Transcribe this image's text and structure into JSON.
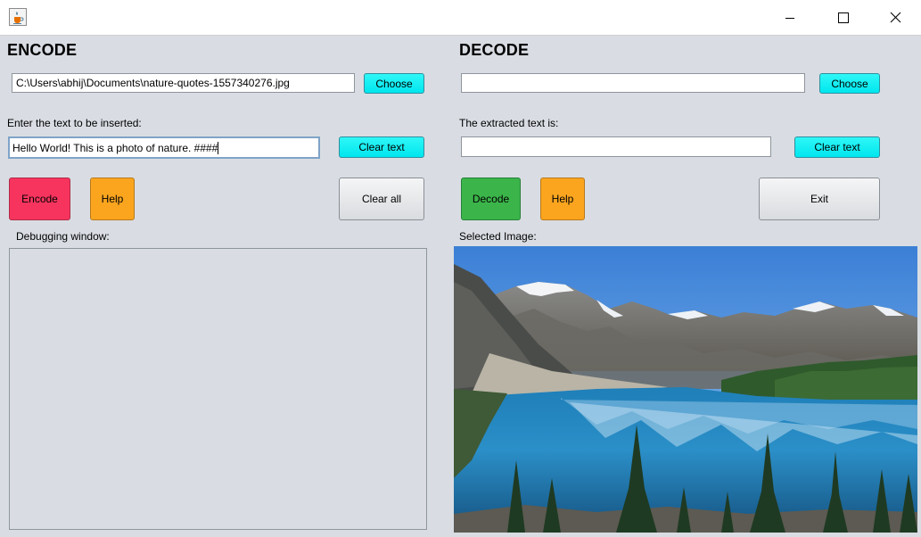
{
  "window": {
    "title": "",
    "icons": [
      "java-cup-icon",
      "minimize-icon",
      "maximize-icon",
      "close-icon"
    ]
  },
  "encode": {
    "heading": "ENCODE",
    "file_path": "C:\\Users\\abhij\\Documents\\nature-quotes-1557340276.jpg",
    "choose_label": "Choose",
    "text_prompt": "Enter the text to be inserted:",
    "text_value": "Hello World! This is a photo of nature. ####",
    "clear_text_label": "Clear text",
    "encode_label": "Encode",
    "help_label": "Help",
    "clear_all_label": "Clear all",
    "debug_label": "Debugging window:"
  },
  "decode": {
    "heading": "DECODE",
    "file_path": "",
    "choose_label": "Choose",
    "extracted_prompt": "The extracted text is:",
    "extracted_value": "",
    "clear_text_label": "Clear text",
    "decode_label": "Decode",
    "help_label": "Help",
    "exit_label": "Exit",
    "image_label": "Selected Image:"
  },
  "colors": {
    "background": "#d9dde3",
    "choose_button": "#00e6ee",
    "encode_button": "#f7345e",
    "help_button": "#fba51f",
    "decode_button": "#3bb54a"
  }
}
